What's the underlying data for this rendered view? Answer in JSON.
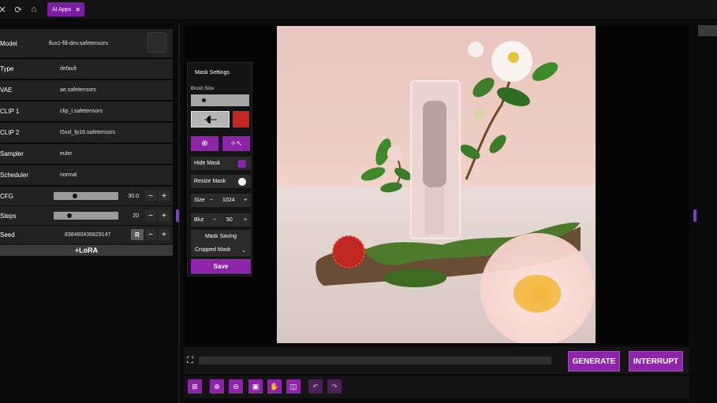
{
  "topbar": {
    "tab_label": "AI Apps",
    "tab_close": "×"
  },
  "params": {
    "model": {
      "label": "Model",
      "value": "flux1-fill-dev.safetensors"
    },
    "type": {
      "label": "Type",
      "value": "default"
    },
    "vae": {
      "label": "VAE",
      "value": "ae.safetensors"
    },
    "clip1": {
      "label": "CLIP 1",
      "value": "clip_l.safetensors"
    },
    "clip2": {
      "label": "CLIP 2",
      "value": "t5xxl_fp16.safetensors"
    },
    "sampler": {
      "label": "Sampler",
      "value": "euler"
    },
    "scheduler": {
      "label": "Scheduler",
      "value": "normal"
    },
    "cfg": {
      "label": "CFG",
      "value": "30.0"
    },
    "steps": {
      "label": "Steps",
      "value": "20"
    },
    "seed": {
      "label": "Seed",
      "value": "838460436829147",
      "random_label": "R"
    },
    "minus": "−",
    "plus": "+",
    "lora_label": "+LoRA"
  },
  "mask": {
    "title": "Mask Settings",
    "brush_size_label": "Brush Size:",
    "hide_mask": "Hide Mask",
    "resize_mask": "Resize Mask",
    "size_label": "Size",
    "size_value": "1024",
    "blur_label": "Blur",
    "blur_value": "50",
    "saving_label": "Mask Saving",
    "saving_option": "Cropped Mask",
    "save_label": "Save",
    "brush_color": "#c0281f"
  },
  "actions": {
    "generate": "GENERATE",
    "interrupt": "INTERRUPT"
  },
  "colors": {
    "accent": "#8e24aa",
    "panel": "#222222",
    "bg": "#0a0a0a"
  }
}
